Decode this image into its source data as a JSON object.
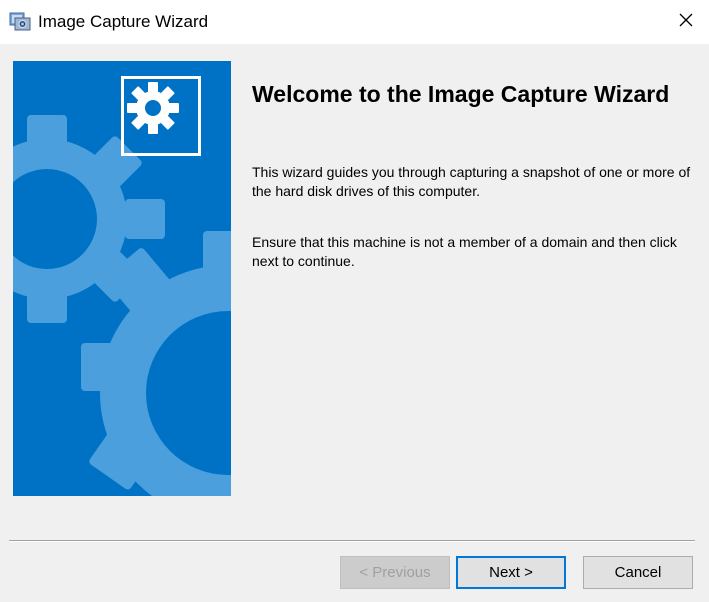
{
  "window": {
    "title": "Image Capture Wizard",
    "app_icon": "image-capture-app-icon",
    "close_icon": "close-icon"
  },
  "banner": {
    "background_color": "#0072c6",
    "gear_color": "#4a9fdc",
    "badge_icon": "gear-icon",
    "decoration_icon": "gears-icon"
  },
  "content": {
    "heading": "Welcome to the Image Capture Wizard",
    "paragraph_1": "This wizard guides you through capturing a snapshot of one or more of the hard disk drives of this computer.",
    "paragraph_2": "Ensure that this machine is not a member of a domain and then click next to continue."
  },
  "buttons": {
    "previous": {
      "label": "< Previous",
      "enabled": false
    },
    "next": {
      "label": "Next >",
      "enabled": true,
      "default": true
    },
    "cancel": {
      "label": "Cancel",
      "enabled": true
    }
  }
}
